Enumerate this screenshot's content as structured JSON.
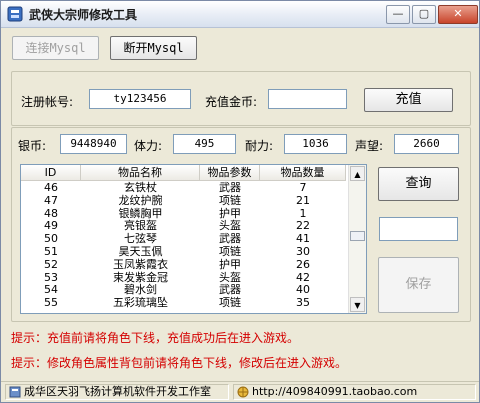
{
  "window": {
    "title": "武侠大宗师修改工具",
    "min_glyph": "—",
    "max_glyph": "▢",
    "close_glyph": "✕"
  },
  "toolbar": {
    "connect_label": "连接Mysql",
    "disconnect_label": "断开Mysql"
  },
  "recharge": {
    "account_label": "注册帐号:",
    "account_value": "ty123456",
    "gold_label": "充值金币:",
    "gold_value": "",
    "recharge_button": "充值"
  },
  "stats": {
    "silver_label": "银币:",
    "silver_value": "9448940",
    "stamina_label": "体力:",
    "stamina_value": "495",
    "endurance_label": "耐力:",
    "endurance_value": "1036",
    "prestige_label": "声望:",
    "prestige_value": "2660"
  },
  "table": {
    "headers": [
      "ID",
      "物品名称",
      "物品参数",
      "物品数量"
    ],
    "rows": [
      [
        "46",
        "玄铁杖",
        "武器",
        "7"
      ],
      [
        "47",
        "龙纹护腕",
        "项链",
        "21"
      ],
      [
        "48",
        "银鳞胸甲",
        "护甲",
        "1"
      ],
      [
        "49",
        "亮银盔",
        "头盔",
        "22"
      ],
      [
        "50",
        "七弦琴",
        "武器",
        "41"
      ],
      [
        "51",
        "昊天玉佩",
        "项链",
        "30"
      ],
      [
        "52",
        "玉凤紫霞衣",
        "护甲",
        "26"
      ],
      [
        "53",
        "束发紫金冠",
        "头盔",
        "42"
      ],
      [
        "54",
        "碧水剑",
        "武器",
        "40"
      ],
      [
        "55",
        "五彩琉璃坠",
        "项链",
        "35"
      ]
    ]
  },
  "side": {
    "query_button": "查询",
    "value_input": "",
    "save_button": "保存"
  },
  "hints": [
    "提示：充值前请将角色下线，充值成功后在进入游戏。",
    "提示：修改角色属性背包前请将角色下线，修改后在进入游戏。"
  ],
  "statusbar": {
    "studio": "成华区天羽飞扬计算机软件开发工作室",
    "shop": "http://409840991.taobao.com"
  }
}
